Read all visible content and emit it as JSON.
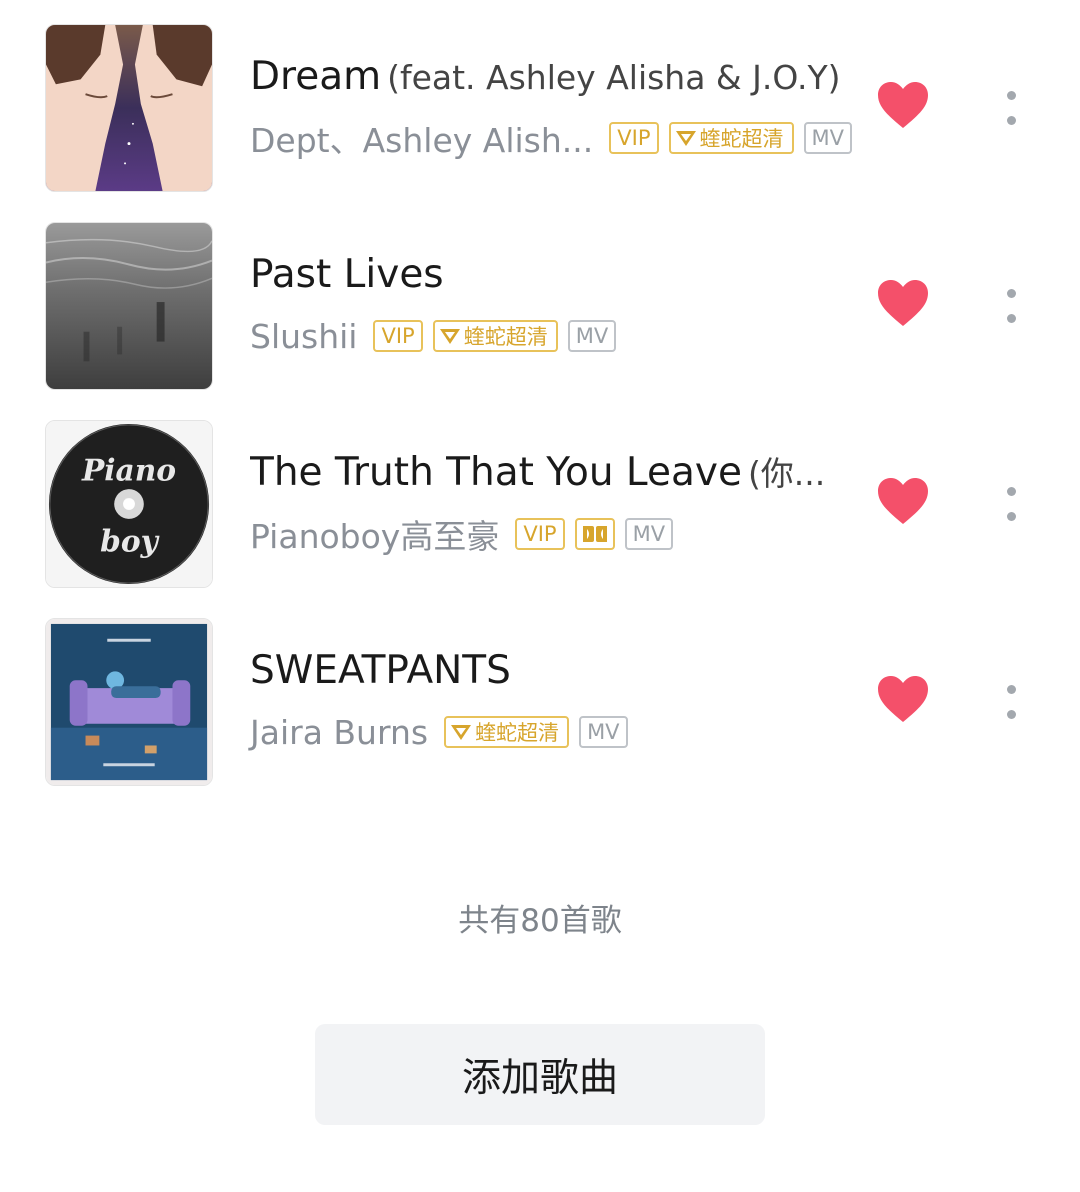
{
  "songs": [
    {
      "title": "Dream",
      "subtitle": "(feat. Ashley Alisha & J.O.Y)",
      "artist": "Dept、Ashley Alish...",
      "tags": {
        "vip": "VIP",
        "hq": "蝰蛇超清",
        "mv": "MV"
      },
      "liked": true,
      "cover_icon": "dream-cover-art"
    },
    {
      "title": "Past Lives",
      "subtitle": "",
      "artist": "Slushii",
      "tags": {
        "vip": "VIP",
        "hq": "蝰蛇超清",
        "mv": "MV"
      },
      "liked": true,
      "cover_icon": "past-lives-cover-art"
    },
    {
      "title": "The Truth That You Leave",
      "subtitle": "(你...",
      "artist": "Pianoboy高至豪",
      "tags": {
        "vip": "VIP",
        "dolby": "dolby-icon",
        "mv": "MV"
      },
      "liked": true,
      "cover_icon": "piano-boy-cd-cover-art",
      "cover_text_top": "Piano",
      "cover_text_bottom": "boy"
    },
    {
      "title": "SWEATPANTS",
      "subtitle": "",
      "artist": "Jaira Burns",
      "tags": {
        "hq": "蝰蛇超清",
        "mv": "MV"
      },
      "liked": true,
      "cover_icon": "sweatpants-cover-art"
    }
  ],
  "footer": {
    "count_text": "共有80首歌",
    "add_button_label": "添加歌曲"
  },
  "colors": {
    "heart": "#f4506a",
    "tag_gold": "#d7a52c",
    "tag_gray": "#9aa0a6",
    "artist_gray": "#8a8f97"
  }
}
